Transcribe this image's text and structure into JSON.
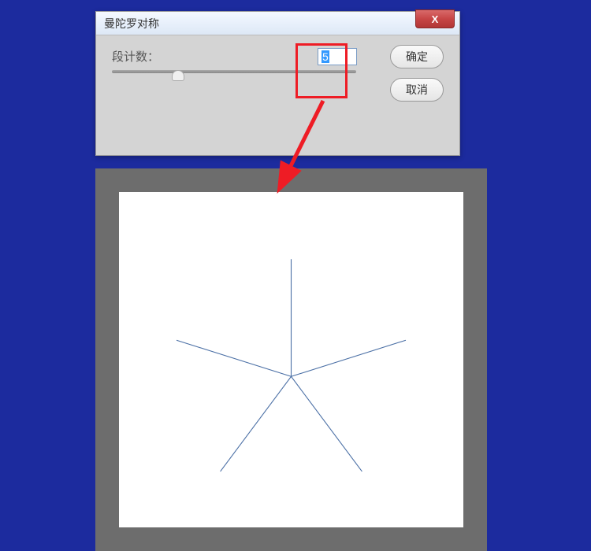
{
  "dialog": {
    "title": "曼陀罗对称",
    "close_label": "X",
    "segment_label": "段计数：",
    "segment_value": "5",
    "slider_value": 5,
    "ok_label": "确定",
    "cancel_label": "取消"
  },
  "annotation": {
    "highlight_color": "#ee1c25",
    "arrow_color": "#ee1c25"
  },
  "chart_data": {
    "type": "radial-lines",
    "segments": 5,
    "center": [
      0.5,
      0.55
    ],
    "radius": 0.35,
    "start_angle_deg": -90,
    "stroke": "#4a6fa5"
  }
}
